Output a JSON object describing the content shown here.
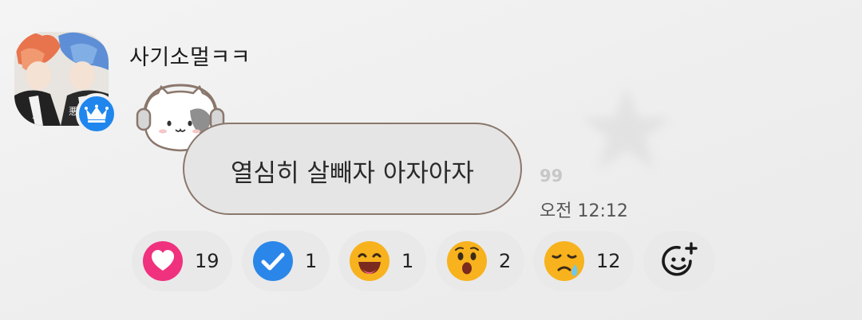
{
  "message": {
    "username": "사기소멀ㅋㅋ",
    "text": "열심히 살빼자 아자아자",
    "quote_count": "99",
    "timestamp": "오전 12:12",
    "avatar_badge_icon": "crown-icon",
    "sticker_icon": "cat-headphones-icon"
  },
  "reactions": [
    {
      "icon": "heart-icon",
      "count": "19",
      "color": "#f0317e"
    },
    {
      "icon": "check-icon",
      "count": "1",
      "color": "#2b86ea"
    },
    {
      "icon": "laughing-face-icon",
      "count": "1",
      "color": "#f7b21d"
    },
    {
      "icon": "surprised-face-icon",
      "count": "2",
      "color": "#f7b21d"
    },
    {
      "icon": "crying-face-icon",
      "count": "12",
      "color": "#f7b21d"
    }
  ],
  "add_reaction_icon": "add-emoji-icon",
  "colors": {
    "bubble_border": "#8a776c",
    "bubble_fill": "#e5e5e5",
    "badge_blue": "#1f86ee"
  }
}
